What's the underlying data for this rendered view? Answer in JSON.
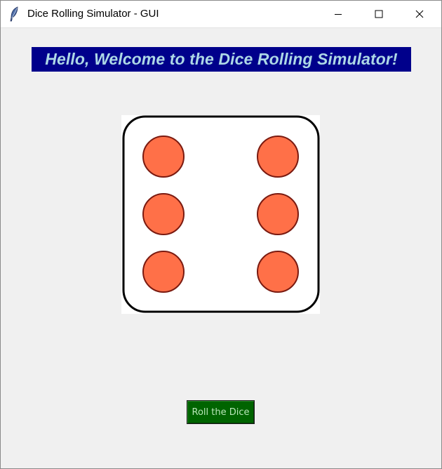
{
  "window": {
    "title": "Dice Rolling Simulator - GUI",
    "icon": "feather-icon",
    "controls": {
      "minimize": "minimize-icon",
      "maximize": "maximize-icon",
      "close": "close-icon"
    }
  },
  "header": {
    "welcome_text": "Hello, Welcome to the Dice Rolling Simulator!",
    "background_color": "#00008b",
    "text_color": "#add8e6"
  },
  "dice": {
    "face_value": 6,
    "face_color": "#ffffff",
    "pip_color": "#ff7048",
    "pip_outline_color": "#7a1a10"
  },
  "roll_button": {
    "label": "Roll the Dice",
    "background_color": "#006400",
    "text_color": "#b8e6b8"
  }
}
